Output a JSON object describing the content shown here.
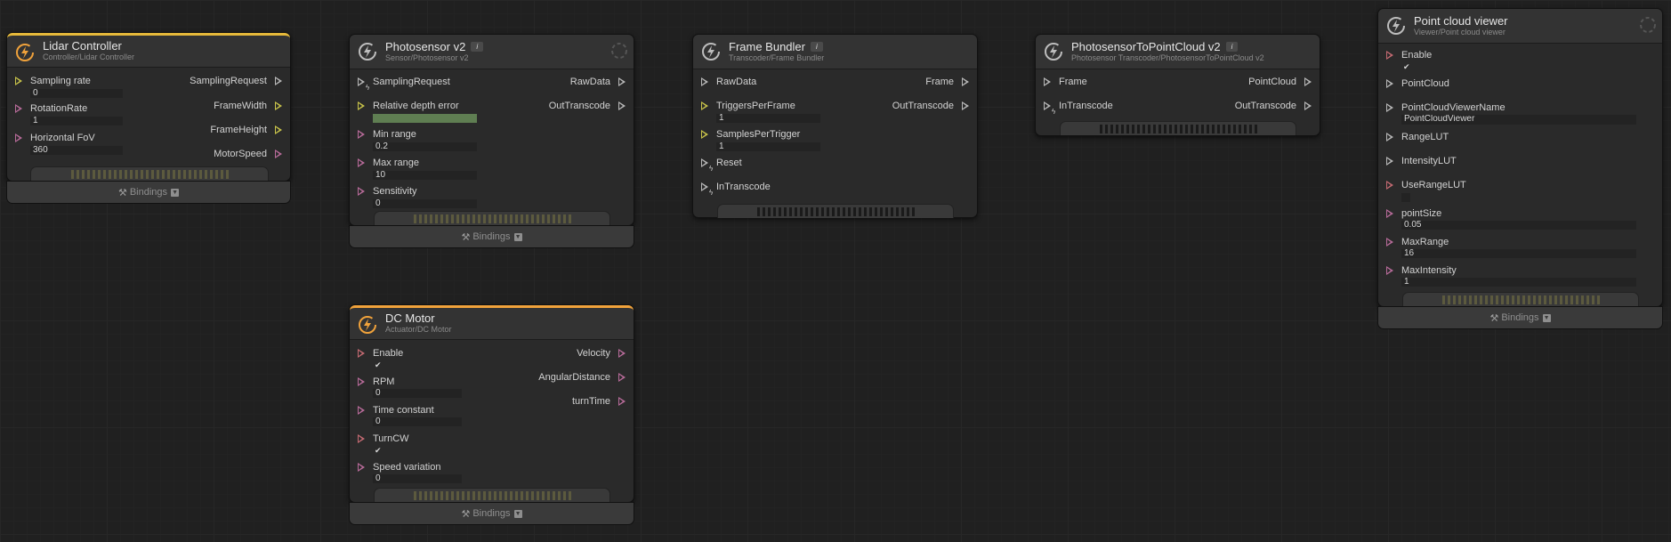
{
  "colors": {
    "orange_accent": "#f0a23b",
    "yellow_accent": "#e6b93a",
    "port_yellow": "#c8c34a",
    "port_red": "#c46a72",
    "port_pink": "#b86b9a",
    "port_white": "#b8b8b8"
  },
  "icons": {
    "node_icon": "refresh-bolt-icon",
    "busy": "spinner-icon",
    "bindings": "wrench-icon",
    "expand": "chevron-down-icon"
  },
  "lidar": {
    "title": "Lidar Controller",
    "subtitle": "Controller/Lidar Controller",
    "inputs": [
      {
        "label": "Sampling rate",
        "value": "0"
      },
      {
        "label": "RotationRate",
        "value": "1"
      },
      {
        "label": "Horizontal FoV",
        "value": "360"
      }
    ],
    "outputs": [
      "SamplingRequest",
      "FrameWidth",
      "FrameHeight",
      "MotorSpeed"
    ],
    "bindings": "Bindings"
  },
  "photosensor": {
    "title": "Photosensor v2",
    "badge": "i",
    "subtitle": "Sensor/Photosensor v2",
    "inputs": [
      {
        "label": "SamplingRequest"
      },
      {
        "label": "Relative depth error",
        "value": ""
      },
      {
        "label": "Min range",
        "value": "0.2"
      },
      {
        "label": "Max range",
        "value": "10"
      },
      {
        "label": "Sensitivity",
        "value": "0"
      }
    ],
    "outputs": [
      "RawData",
      "OutTranscode"
    ],
    "bindings": "Bindings"
  },
  "frame_bundler": {
    "title": "Frame Bundler",
    "badge": "i",
    "subtitle": "Transcoder/Frame Bundler",
    "inputs": [
      {
        "label": "RawData"
      },
      {
        "label": "TriggersPerFrame",
        "value": "1"
      },
      {
        "label": "SamplesPerTrigger",
        "value": "1"
      },
      {
        "label": "Reset"
      },
      {
        "label": "InTranscode"
      }
    ],
    "outputs": [
      "Frame",
      "OutTranscode"
    ]
  },
  "p2pc": {
    "title": "PhotosensorToPointCloud v2",
    "badge": "i",
    "subtitle": "Photosensor Transcoder/PhotosensorToPointCloud v2",
    "inputs": [
      {
        "label": "Frame"
      },
      {
        "label": "InTranscode"
      }
    ],
    "outputs": [
      "PointCloud",
      "OutTranscode"
    ]
  },
  "viewer": {
    "title": "Point cloud viewer",
    "subtitle": "Viewer/Point cloud viewer",
    "inputs": [
      {
        "label": "Enable",
        "value": "✔"
      },
      {
        "label": "PointCloud"
      },
      {
        "label": "PointCloudViewerName",
        "value": "PointCloudViewer"
      },
      {
        "label": "RangeLUT"
      },
      {
        "label": "IntensityLUT"
      },
      {
        "label": "UseRangeLUT",
        "value": ""
      },
      {
        "label": "pointSize",
        "value": "0.05"
      },
      {
        "label": "MaxRange",
        "value": "16"
      },
      {
        "label": "MaxIntensity",
        "value": "1"
      }
    ],
    "bindings": "Bindings"
  },
  "dc_motor": {
    "title": "DC Motor",
    "subtitle": "Actuator/DC Motor",
    "inputs": [
      {
        "label": "Enable",
        "value": "✔"
      },
      {
        "label": "RPM",
        "value": "0"
      },
      {
        "label": "Time constant",
        "value": "0"
      },
      {
        "label": "TurnCW",
        "value": "✔"
      },
      {
        "label": "Speed variation",
        "value": "0"
      }
    ],
    "outputs": [
      "Velocity",
      "AngularDistance",
      "turnTime"
    ],
    "bindings": "Bindings"
  }
}
